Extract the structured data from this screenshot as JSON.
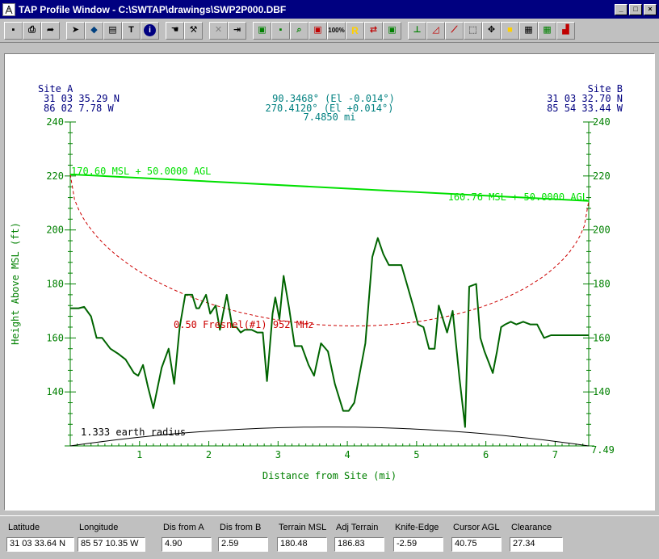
{
  "window": {
    "title": "TAP Profile Window - C:\\SWTAP\\drawings\\SWP2P000.DBF",
    "buttons": [
      "_",
      "□",
      "×"
    ]
  },
  "toolbar": {
    "groups": [
      [
        {
          "name": "save-icon",
          "glyph": "▪",
          "color": "#000"
        },
        {
          "name": "print-icon",
          "glyph": "⎙",
          "color": "#000"
        },
        {
          "name": "export-arrow-icon",
          "glyph": "➦",
          "color": "#000"
        }
      ],
      [
        {
          "name": "pointer-icon",
          "glyph": "➤",
          "color": "#000"
        },
        {
          "name": "fill-icon",
          "glyph": "◆",
          "color": "#004080"
        },
        {
          "name": "clipboard-icon",
          "glyph": "▤",
          "color": "#000"
        },
        {
          "name": "text-icon",
          "glyph": "T",
          "color": "#000"
        },
        {
          "name": "info-icon",
          "glyph": "i",
          "color": "#fff"
        }
      ],
      [
        {
          "name": "hand-icon",
          "glyph": "☚",
          "color": "#000"
        },
        {
          "name": "wrench-icon",
          "glyph": "⚒",
          "color": "#000"
        }
      ],
      [
        {
          "name": "cut-icon",
          "glyph": "✕",
          "color": "#808080"
        },
        {
          "name": "insert-icon",
          "glyph": "⇥",
          "color": "#000"
        }
      ],
      [
        {
          "name": "terrain-plot-icon",
          "glyph": "▣",
          "color": "#008000"
        },
        {
          "name": "terrain-point-icon",
          "glyph": "▪",
          "color": "#008000"
        },
        {
          "name": "zoom-icon",
          "glyph": "⌕",
          "color": "#008000"
        },
        {
          "name": "terrain-delete-icon",
          "glyph": "▣",
          "color": "#c00000"
        },
        {
          "name": "zoom-100-icon",
          "glyph": "100%",
          "color": "#000"
        },
        {
          "name": "reflection-icon",
          "glyph": "R",
          "color": "#ffd000"
        },
        {
          "name": "terrain-swap-icon",
          "glyph": "⇄",
          "color": "#c00000"
        },
        {
          "name": "terrain-clear-icon",
          "glyph": "▣",
          "color": "#008000"
        }
      ],
      [
        {
          "name": "obstacle-icon",
          "glyph": "⊥",
          "color": "#008000"
        },
        {
          "name": "profile-edit-icon",
          "glyph": "◿",
          "color": "#c00000"
        },
        {
          "name": "fresnel-icon",
          "glyph": "⟋",
          "color": "#c00000"
        },
        {
          "name": "select-area-icon",
          "glyph": "⬚",
          "color": "#000"
        },
        {
          "name": "move-icon",
          "glyph": "✥",
          "color": "#000"
        },
        {
          "name": "color-icon",
          "glyph": "■",
          "color": "#ffd000"
        },
        {
          "name": "grid-icon",
          "glyph": "▦",
          "color": "#000"
        },
        {
          "name": "grid-color-icon",
          "glyph": "▦",
          "color": "#008000"
        },
        {
          "name": "histogram-icon",
          "glyph": "▟",
          "color": "#c00000"
        }
      ]
    ]
  },
  "profile": {
    "site_a": {
      "label": "Site A",
      "lat": "31 03 35.29 N",
      "lon": "86 02 7.78 W"
    },
    "site_b": {
      "label": "Site B",
      "lat": "31 03 32.70 N",
      "lon": "85 54 33.44 W"
    },
    "azimuth_ab": "90.3468° (El -0.014°)",
    "azimuth_ba": "270.4120° (El +0.014°)",
    "distance": "7.4850 mi",
    "ylabel": "Height Above MSL (ft)",
    "xlabel": "Distance from Site (mi)",
    "site_a_antenna_label": "170.60 MSL + 50.0000 AGL",
    "site_b_antenna_label": "160.76 MSL + 50.0000 AGL",
    "fresnel_label": "0.50 Fresnel(#1) 952 MHz",
    "earth_label": "1.333 earth radius",
    "end_label": "7.49",
    "colors": {
      "info_text": "#008080",
      "site_text": "#000080",
      "axis": "#008000",
      "terrain": "#006400",
      "beam": "#00e000",
      "fresnel": "#cc0000",
      "earth": "#000000"
    }
  },
  "chart_data": {
    "type": "line",
    "xlim": [
      0,
      7.485
    ],
    "ylim": [
      120,
      240
    ],
    "yticks": [
      140,
      160,
      180,
      200,
      220,
      240
    ],
    "xticks": [
      1,
      2,
      3,
      4,
      5,
      6,
      7
    ],
    "series": [
      {
        "name": "terrain",
        "x": [
          0,
          0.12,
          0.2,
          0.3,
          0.38,
          0.46,
          0.58,
          0.7,
          0.8,
          0.92,
          0.98,
          1.05,
          1.12,
          1.2,
          1.32,
          1.42,
          1.5,
          1.58,
          1.66,
          1.76,
          1.82,
          1.86,
          1.96,
          2.02,
          2.1,
          2.16,
          2.26,
          2.34,
          2.4,
          2.46,
          2.52,
          2.62,
          2.7,
          2.78,
          2.84,
          2.92,
          2.96,
          3.02,
          3.08,
          3.16,
          3.24,
          3.34,
          3.44,
          3.52,
          3.62,
          3.72,
          3.82,
          3.94,
          4.02,
          4.1,
          4.18,
          4.26,
          4.36,
          4.44,
          4.52,
          4.6,
          4.7,
          4.78,
          4.86,
          4.96,
          5.02,
          5.1,
          5.18,
          5.26,
          5.32,
          5.44,
          5.52,
          5.62,
          5.7,
          5.76,
          5.86,
          5.92,
          5.98,
          6.04,
          6.1,
          6.16,
          6.22,
          6.28,
          6.36,
          6.44,
          6.54,
          6.64,
          6.74,
          6.84,
          6.94,
          7.04,
          7.14,
          7.24,
          7.32,
          7.4,
          7.485
        ],
        "y": [
          171,
          171,
          171.5,
          168,
          160,
          160,
          156,
          154,
          152,
          147,
          146,
          150,
          142,
          134,
          149,
          156,
          143,
          164,
          176,
          176,
          171,
          171,
          176,
          169,
          172,
          163,
          176,
          164,
          164,
          162,
          163,
          163,
          162,
          162,
          144,
          169,
          175,
          167,
          183,
          171,
          157,
          157,
          150,
          146,
          158,
          155,
          143,
          133,
          133,
          136,
          147,
          158,
          190,
          197,
          191,
          187,
          187,
          187,
          180,
          171,
          165,
          164,
          156,
          156,
          172,
          162,
          170,
          145,
          127,
          179,
          180,
          160,
          155,
          151,
          147,
          155,
          164,
          165,
          166,
          165,
          166,
          165,
          165,
          160,
          161,
          161,
          161,
          161,
          161,
          161,
          161
        ]
      },
      {
        "name": "antenna line",
        "x": [
          0,
          7.485
        ],
        "y": [
          220.6,
          210.76
        ]
      },
      {
        "name": "fresnel zone",
        "type": "curve",
        "center_height_range": [
          220.6,
          210.76
        ],
        "radius_ft_at_mid": 51
      },
      {
        "name": "earth curvature",
        "k_factor": 1.333,
        "bulge_ft_at_mid": 7
      }
    ]
  },
  "status": {
    "fields": [
      {
        "name": "latitude",
        "label": "Latitude",
        "value": "31 03 33.64 N"
      },
      {
        "name": "longitude",
        "label": "Longitude",
        "value": "85 57 10.35 W"
      },
      {
        "name": "dis-from-a",
        "label": "Dis from A",
        "value": "4.90"
      },
      {
        "name": "dis-from-b",
        "label": "Dis from B",
        "value": "2.59"
      },
      {
        "name": "terrain-msl",
        "label": "Terrain MSL",
        "value": "180.48"
      },
      {
        "name": "adj-terrain",
        "label": "Adj Terrain",
        "value": "186.83"
      },
      {
        "name": "knife-edge",
        "label": "Knife-Edge",
        "value": "-2.59"
      },
      {
        "name": "cursor-agl",
        "label": "Cursor AGL",
        "value": "40.75"
      },
      {
        "name": "clearance",
        "label": "Clearance",
        "value": "27.34"
      }
    ]
  }
}
